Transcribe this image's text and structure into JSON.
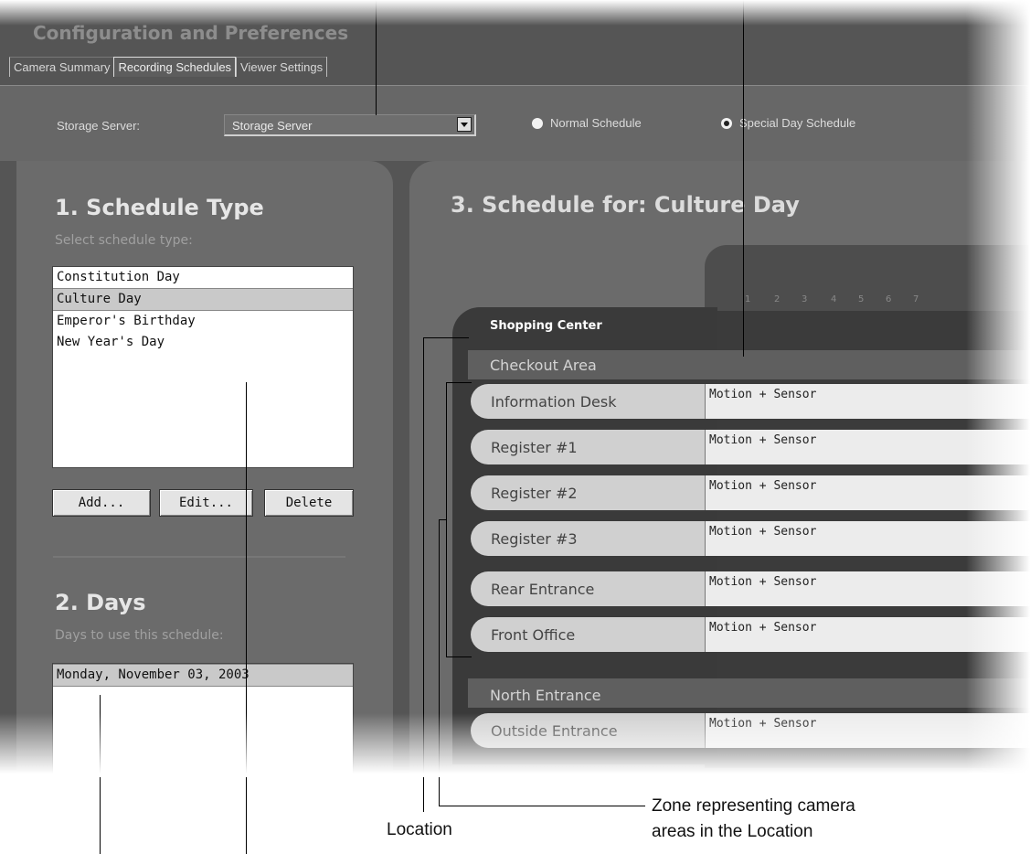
{
  "app": {
    "title": "Configuration and Preferences"
  },
  "tabs": [
    {
      "label": "Camera Summary",
      "active": false
    },
    {
      "label": "Recording Schedules",
      "active": true
    },
    {
      "label": "Viewer Settings",
      "active": false
    }
  ],
  "storage": {
    "label": "Storage Server:",
    "value": "Storage Server",
    "radio_normal": "Normal Schedule",
    "radio_special": "Special Day Schedule",
    "selected_radio": "Special Day Schedule"
  },
  "schedule_type": {
    "heading": "1. Schedule Type",
    "subheading": "Select schedule type:",
    "items": [
      "Constitution Day",
      "Culture Day",
      "Emperor's Birthday",
      "New Year's Day"
    ],
    "selected": "Culture Day",
    "add_label": "Add...",
    "edit_label": "Edit...",
    "delete_label": "Delete"
  },
  "days": {
    "heading": "2. Days",
    "subheading": "Days to use this schedule:",
    "items": [
      "Monday, November 03, 2003"
    ]
  },
  "schedule": {
    "title": "3. Schedule for: Culture Day",
    "hours": [
      "1",
      "2",
      "3",
      "4",
      "5",
      "6",
      "7"
    ],
    "location": "Shopping Center",
    "zones": [
      {
        "name": "Checkout Area",
        "cameras": [
          {
            "name": "Information Desk",
            "schedule": "Motion + Sensor"
          },
          {
            "name": "Register #1",
            "schedule": "Motion + Sensor"
          },
          {
            "name": "Register #2",
            "schedule": "Motion + Sensor"
          },
          {
            "name": "Register #3",
            "schedule": "Motion + Sensor"
          },
          {
            "name": "Rear Entrance",
            "schedule": "Motion + Sensor"
          },
          {
            "name": "Front Office",
            "schedule": "Motion + Sensor"
          }
        ]
      },
      {
        "name": "North Entrance",
        "cameras": [
          {
            "name": "Outside Entrance",
            "schedule": "Motion + Sensor"
          }
        ]
      }
    ]
  },
  "annotations": {
    "location": "Location",
    "zone_line1": "Zone representing camera",
    "zone_line2": "areas in the Location"
  }
}
